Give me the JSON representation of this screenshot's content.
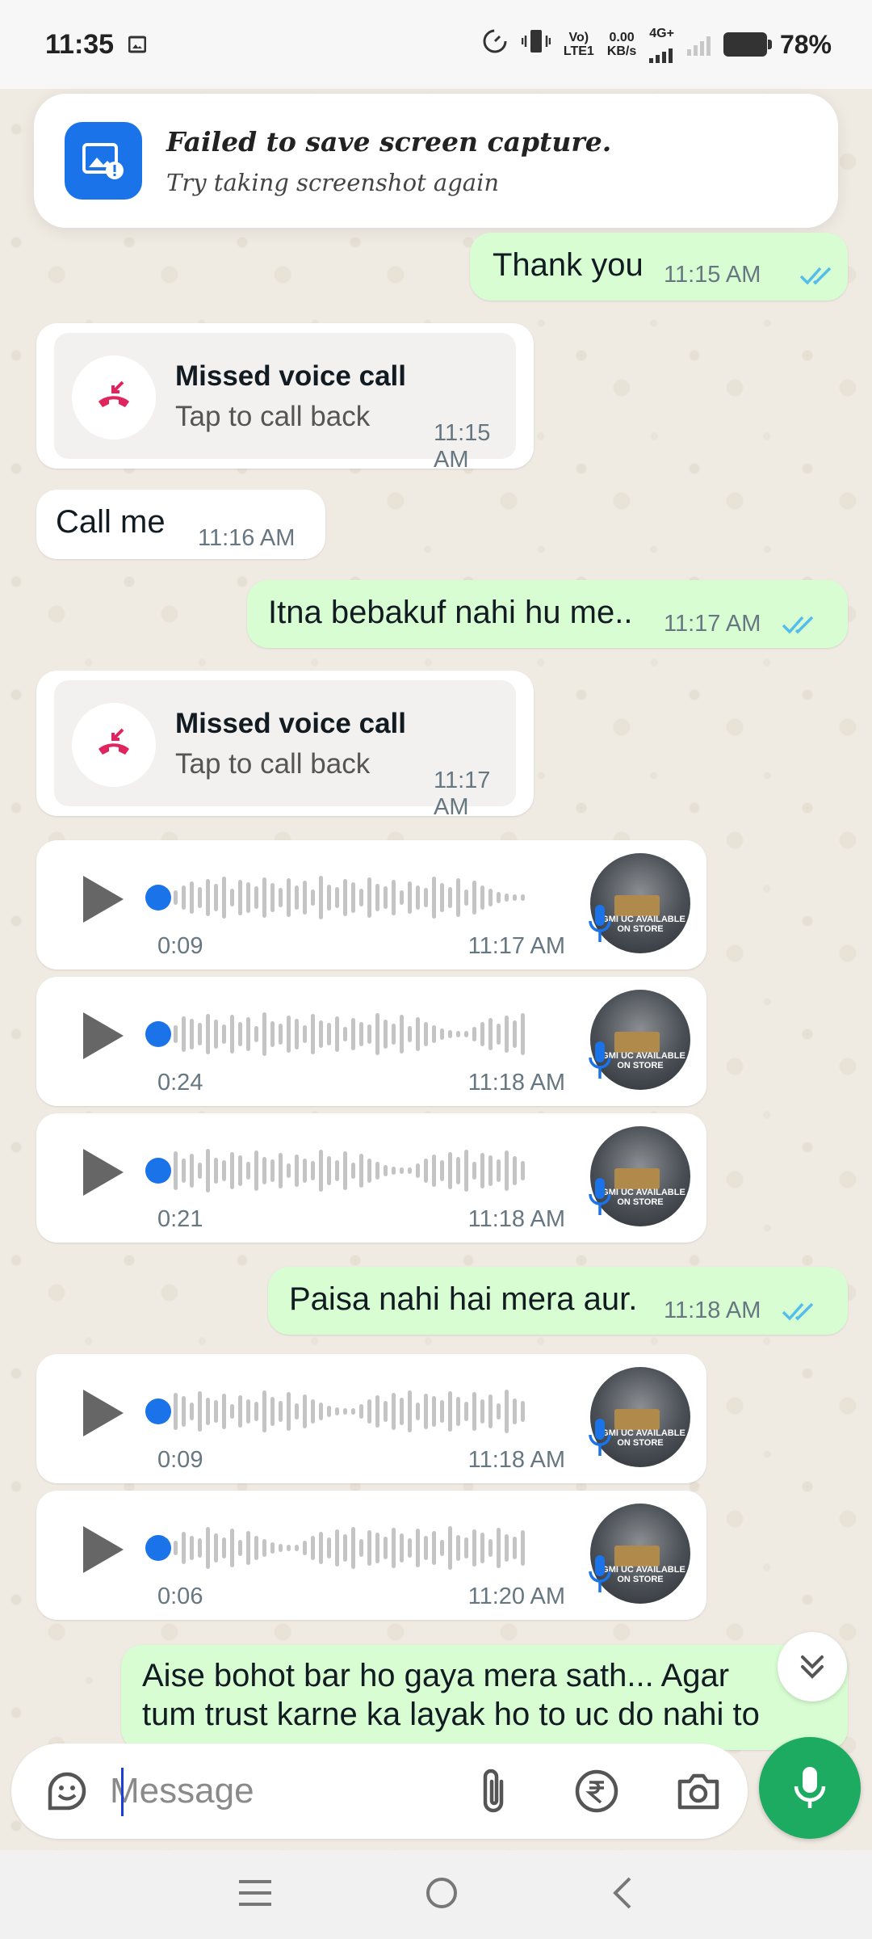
{
  "status_bar": {
    "time": "11:35",
    "net_top": "Vo)",
    "net_bottom": "LTE1",
    "speed_top": "0.00",
    "speed_bottom": "KB/s",
    "network_type": "4G+",
    "battery": "78%"
  },
  "toast": {
    "title": "Failed to save screen capture.",
    "subtitle": "Try taking screenshot again",
    "icon": "screenshot-error-icon"
  },
  "messages": [
    {
      "type": "text",
      "direction": "out",
      "text": "Thank you",
      "time": "11:15 AM",
      "read": true
    },
    {
      "type": "missed_call",
      "direction": "in",
      "title": "Missed voice call",
      "subtitle": "Tap to call back",
      "time": "11:15 AM"
    },
    {
      "type": "text",
      "direction": "in",
      "text": "Call me",
      "time": "11:16 AM"
    },
    {
      "type": "text",
      "direction": "out",
      "text": "Itna bebakuf nahi hu me..",
      "time": "11:17 AM",
      "read": true
    },
    {
      "type": "missed_call",
      "direction": "in",
      "title": "Missed voice call",
      "subtitle": "Tap to call back",
      "time": "11:17 AM"
    },
    {
      "type": "voice",
      "direction": "in",
      "duration": "0:09",
      "time": "11:17 AM",
      "avatar_text": "BGMI UC AVAILABLE ON STORE"
    },
    {
      "type": "voice",
      "direction": "in",
      "duration": "0:24",
      "time": "11:18 AM",
      "avatar_text": "BGMI UC AVAILABLE ON STORE"
    },
    {
      "type": "voice",
      "direction": "in",
      "duration": "0:21",
      "time": "11:18 AM",
      "avatar_text": "BGMI UC AVAILABLE ON STORE"
    },
    {
      "type": "text",
      "direction": "out",
      "text": "Paisa nahi hai mera aur.",
      "time": "11:18 AM",
      "read": true
    },
    {
      "type": "voice",
      "direction": "in",
      "duration": "0:09",
      "time": "11:18 AM",
      "avatar_text": "BGMI UC AVAILABLE ON STORE"
    },
    {
      "type": "voice",
      "direction": "in",
      "duration": "0:06",
      "time": "11:20 AM",
      "avatar_text": "BGMI UC AVAILABLE ON STORE"
    },
    {
      "type": "text",
      "direction": "out",
      "text_line1": "Aise bohot bar ho gaya mera sath... Agar",
      "text_line2": "tum trust karne ka layak ho to uc do nahi to"
    }
  ],
  "composer": {
    "placeholder": "Message",
    "icons": [
      "sticker-icon",
      "attach-icon",
      "rupee-payment-icon",
      "camera-icon",
      "mic-icon"
    ]
  },
  "colors": {
    "outgoing_bubble": "#d9fdd3",
    "incoming_bubble": "#ffffff",
    "wallpaper": "#efeae2",
    "accent_green": "#1daa61",
    "read_ticks": "#53bdeb",
    "missed_call_red": "#e0245e"
  }
}
